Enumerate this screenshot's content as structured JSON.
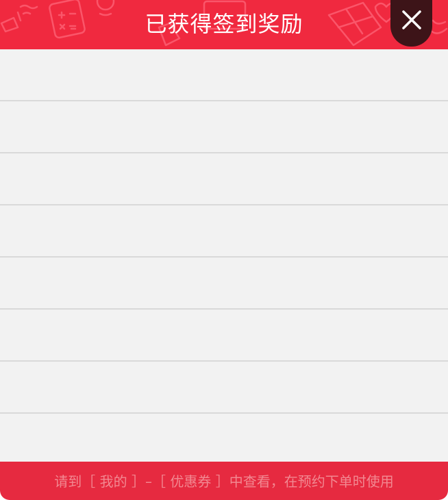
{
  "dialog": {
    "title": "已获得签到奖励",
    "close_icon": "close-icon",
    "reward_rows": [
      "",
      "",
      "",
      "",
      "",
      "",
      "",
      ""
    ],
    "footer_hint": "请到［ 我的 ］–［ 优惠券 ］中查看，在预约下单时使用"
  },
  "colors": {
    "header": "#f0293f",
    "close_button": "#3d1418",
    "list_background": "#f2f2f2",
    "divider": "#d9d9d9",
    "footer": "#e62a40",
    "footer_text": "#f28891"
  }
}
